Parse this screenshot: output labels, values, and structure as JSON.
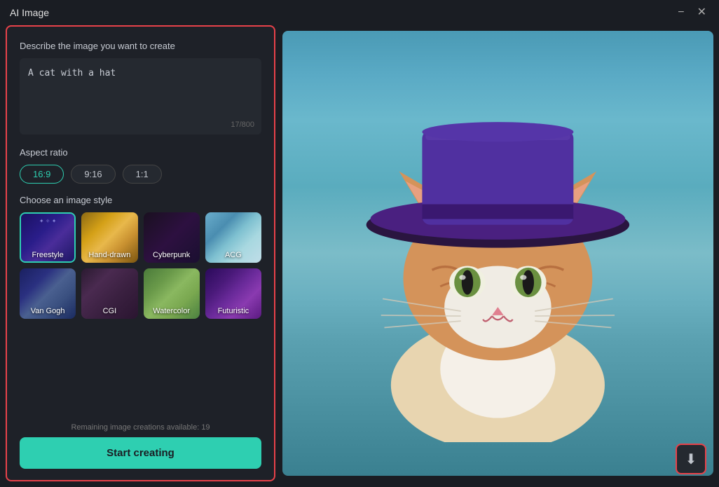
{
  "window": {
    "title": "AI Image",
    "minimize_label": "−",
    "close_label": "✕"
  },
  "left_panel": {
    "prompt_label": "Describe the image you want to create",
    "prompt_value": "A cat with a hat",
    "char_count": "17/800",
    "aspect_label": "Aspect ratio",
    "aspect_options": [
      {
        "value": "16:9",
        "active": true
      },
      {
        "value": "9:16",
        "active": false
      },
      {
        "value": "1:1",
        "active": false
      }
    ],
    "style_label": "Choose an image style",
    "styles": [
      {
        "id": "freestyle",
        "label": "Freestyle",
        "selected": true
      },
      {
        "id": "handdrawn",
        "label": "Hand-drawn",
        "selected": false
      },
      {
        "id": "cyberpunk",
        "label": "Cyberpunk",
        "selected": false
      },
      {
        "id": "acg",
        "label": "ACG",
        "selected": false
      },
      {
        "id": "vangogh",
        "label": "Van Gogh",
        "selected": false
      },
      {
        "id": "cgi",
        "label": "CGI",
        "selected": false
      },
      {
        "id": "watercolor",
        "label": "Watercolor",
        "selected": false
      },
      {
        "id": "futuristic",
        "label": "Futuristic",
        "selected": false
      }
    ],
    "remaining_text": "Remaining image creations available: 19",
    "start_button": "Start creating"
  },
  "right_panel": {
    "download_icon": "⬇"
  }
}
